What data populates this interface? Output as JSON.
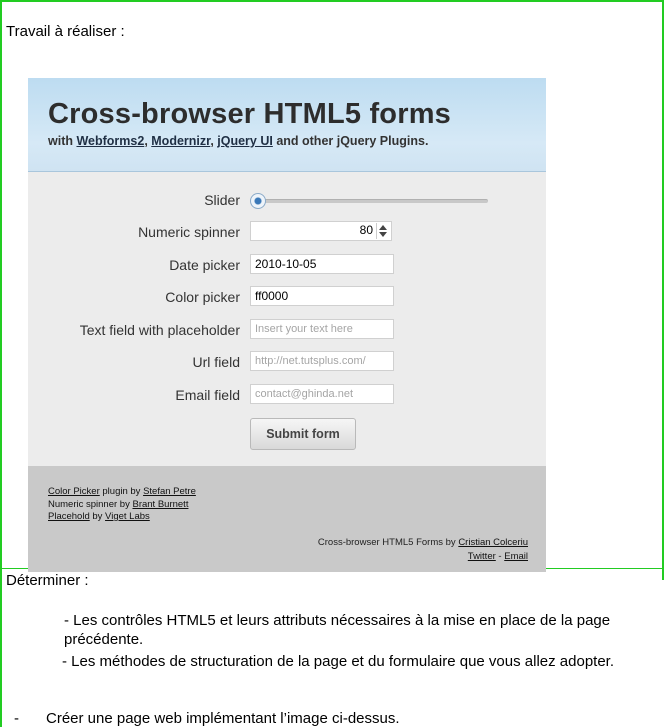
{
  "document": {
    "intro": "Travail à réaliser :",
    "determiner": "Déterminer :",
    "items": [
      "- Les contrôles HTML5 et  leurs attributs nécessaires à la mise en place de la page précédente.",
      "- Les méthodes de structuration de la page et du formulaire que vous allez adopter."
    ],
    "task_dash": "-",
    "task": "Créer une page web implémentant l’image ci-dessus."
  },
  "shot": {
    "title": "Cross-browser HTML5 forms",
    "subtitle_prefix": "with ",
    "links": [
      "Webforms2",
      "Modernizr",
      "jQuery UI"
    ],
    "subtitle_sep": ", ",
    "subtitle_suffix": " and other jQuery Plugins.",
    "fields": {
      "slider_label": "Slider",
      "spinner_label": "Numeric spinner",
      "spinner_value": "80",
      "date_label": "Date picker",
      "date_value": "2010-10-05",
      "color_label": "Color picker",
      "color_value": "ff0000",
      "text_label": "Text field with placeholder",
      "text_placeholder": "Insert your text here",
      "url_label": "Url field",
      "url_placeholder": "http://net.tutsplus.com/",
      "email_label": "Email field",
      "email_placeholder": "contact@ghinda.net"
    },
    "slider_level": 0,
    "submit_label": "Submit form",
    "footer": {
      "line1_link": "Color Picker",
      "line1_mid": " plugin by ",
      "line1_author": "Stefan Petre",
      "line2_text": "Numeric spinner by ",
      "line2_author": "Brant Burnett",
      "line3_link": "Placehold",
      "line3_mid": " by ",
      "line3_author": "Viget Labs",
      "right_text": "Cross-browser HTML5 Forms by ",
      "right_author": "Cristian Colceriu",
      "twitter": "Twitter",
      "dash": " - ",
      "email": "Email"
    }
  },
  "colors": {
    "frame": "#22cc22",
    "header": "#cfe3f2",
    "footer": "#c9c9c9"
  }
}
